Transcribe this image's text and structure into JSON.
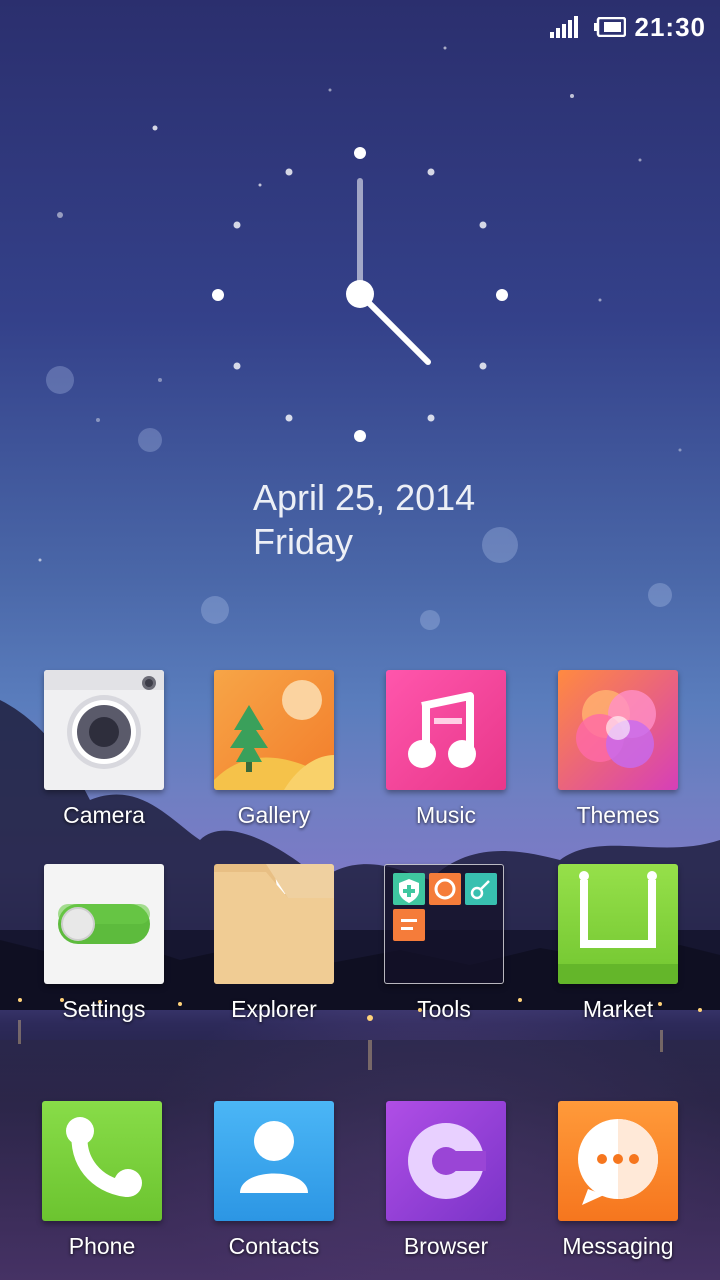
{
  "status_bar": {
    "time": "21:30"
  },
  "clock_widget": {
    "date": "April 25, 2014",
    "weekday": "Friday"
  },
  "apps_row1": [
    {
      "label": "Camera",
      "icon": "camera-icon"
    },
    {
      "label": "Gallery",
      "icon": "gallery-icon"
    },
    {
      "label": "Music",
      "icon": "music-icon"
    },
    {
      "label": "Themes",
      "icon": "themes-icon"
    }
  ],
  "apps_row2": [
    {
      "label": "Settings",
      "icon": "settings-icon"
    },
    {
      "label": "Explorer",
      "icon": "explorer-icon"
    },
    {
      "label": "Tools",
      "icon": "tools-folder-icon"
    },
    {
      "label": "Market",
      "icon": "market-icon"
    }
  ],
  "dock": [
    {
      "label": "Phone",
      "icon": "phone-icon"
    },
    {
      "label": "Contacts",
      "icon": "contacts-icon"
    },
    {
      "label": "Browser",
      "icon": "browser-icon"
    },
    {
      "label": "Messaging",
      "icon": "messaging-icon"
    }
  ],
  "colors": {
    "music": "#f0489a",
    "gallery": "#f59a3a",
    "camera": "#f2f2f2",
    "settings": "#f4f4f4",
    "explorer": "#efc98d",
    "market": "#8bd43e",
    "phone": "#7cd43a",
    "contacts": "#3aa6ee",
    "browser": "#9a45d6",
    "messaging": "#fb8a2e"
  }
}
